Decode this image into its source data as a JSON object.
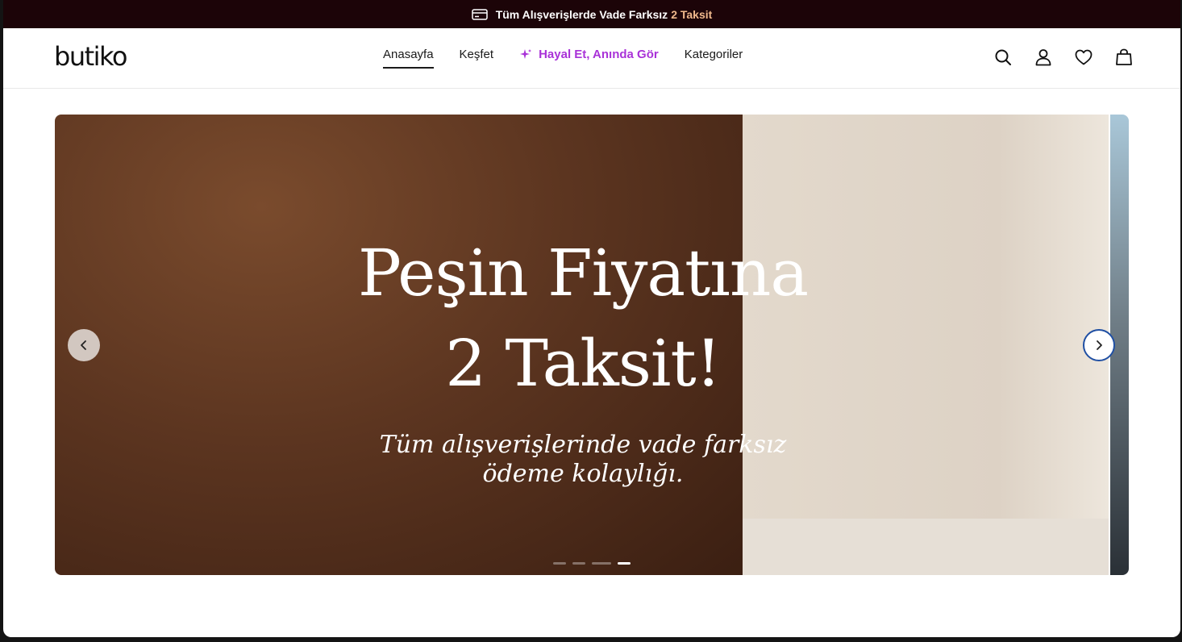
{
  "promo": {
    "text": "Tüm Alışverişlerde Vade Farksız",
    "accent": "2 Taksit",
    "icon": "credit-card-icon"
  },
  "header": {
    "logo": "butiko",
    "nav": [
      {
        "label": "Anasayfa",
        "active": true
      },
      {
        "label": "Keşfet"
      },
      {
        "label": "Hayal Et, Anında Gör",
        "icon": "sparkle-icon"
      },
      {
        "label": "Kategoriler"
      }
    ],
    "icons": [
      "search-icon",
      "user-icon",
      "heart-icon",
      "bag-icon"
    ]
  },
  "hero": {
    "headline_1": "Peşin Fiyatına",
    "headline_2": "2 Taksit!",
    "subline_1": "Tüm alışverişlerinde vade farksız",
    "subline_2": "ödeme kolaylığı.",
    "slides": 4,
    "active_slide": 4
  },
  "colors": {
    "promo_bg": "#1c0408",
    "promo_accent": "#f0b98c",
    "magic_nav": "#a932d8"
  }
}
